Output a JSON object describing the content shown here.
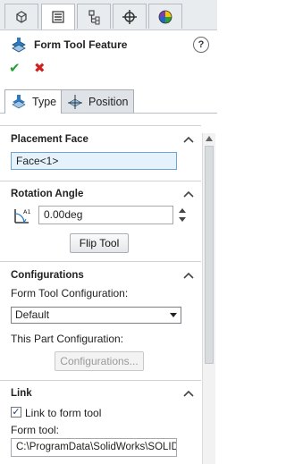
{
  "manager_tabs": [
    {
      "icon": "feature-manager-icon"
    },
    {
      "icon": "property-manager-icon"
    },
    {
      "icon": "configuration-manager-icon"
    },
    {
      "icon": "dimxpert-manager-icon"
    },
    {
      "icon": "display-manager-icon"
    }
  ],
  "header": {
    "title": "Form Tool Feature",
    "help": "?",
    "ok": "✔",
    "cancel": "✖"
  },
  "sub_tabs": [
    {
      "label": "Type"
    },
    {
      "label": "Position"
    }
  ],
  "placement": {
    "title": "Placement Face",
    "face": "Face<1>"
  },
  "rotation": {
    "title": "Rotation Angle",
    "value": "0.00deg",
    "flip_label": "Flip Tool"
  },
  "configurations": {
    "title": "Configurations",
    "form_tool_label": "Form Tool Configuration:",
    "form_tool_value": "Default",
    "this_part_label": "This Part Configuration:",
    "button_label": "Configurations..."
  },
  "link": {
    "title": "Link",
    "checkbox_label": "Link to form tool",
    "checked": true,
    "path_label": "Form tool:",
    "path_value": "C:\\ProgramData\\SolidWorks\\SOLID"
  },
  "colors": {
    "accent": "#6fa3d2",
    "ok": "#28a035",
    "cancel": "#d02020"
  }
}
